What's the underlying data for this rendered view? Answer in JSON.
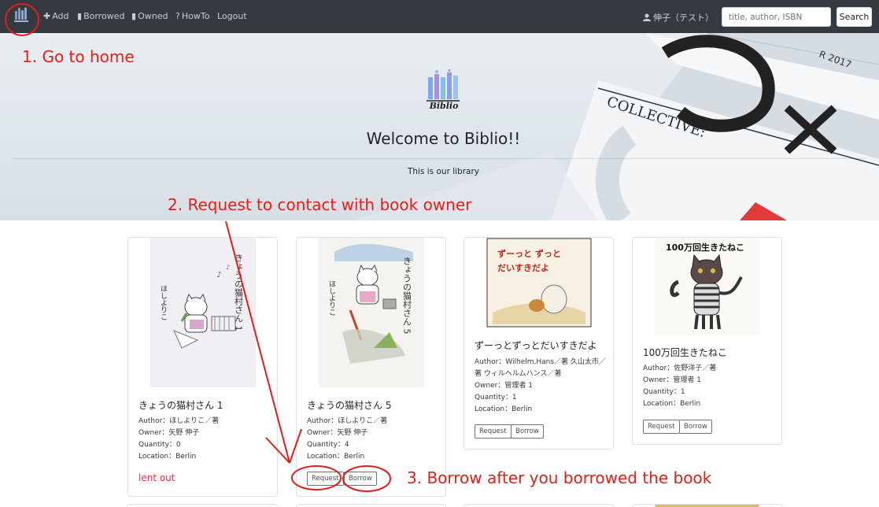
{
  "nav": {
    "add": "Add",
    "borrowed": "Borrowed",
    "owned": "Owned",
    "howto": "HowTo",
    "logout": "Logout",
    "user": "伸子（テスト）",
    "search_placeholder": "title, author, ISBN",
    "search_button": "Search"
  },
  "hero": {
    "logo_text": "Biblio",
    "title": "Welcome to Biblio!!",
    "subtitle": "This is our library"
  },
  "books": [
    {
      "title": "きょうの猫村さん 1",
      "author": "Author：ほしよりこ／著",
      "owner": "Owner：矢野 伸子",
      "quantity": "Quantity：0",
      "location": "Location：Berlin",
      "status": "lent out",
      "cover_text": "きょうの猫村さん 1",
      "cover_author": "ほしよりこ"
    },
    {
      "title": "きょうの猫村さん 5",
      "author": "Author：ほしよりこ／著",
      "owner": "Owner：矢野 伸子",
      "quantity": "Quantity：4",
      "location": "Location：Berlin",
      "cover_text": "きょうの猫村さん 5",
      "cover_author": "ほしよりこ"
    },
    {
      "title": "ずーっとずっとだいすきだよ",
      "author_line1": "Author：Wilhelm,Hans／著 久山太市／",
      "author_line2": "著 ウィルヘルムハンス／著",
      "owner": "Owner：管理者 1",
      "quantity": "Quantity：1",
      "location": "Location：Berlin",
      "cover_text_1": "ずーっと ずっと",
      "cover_text_2": "だいすきだよ"
    },
    {
      "title": "100万回生きたねこ",
      "author": "Author：佐野洋子／著",
      "owner": "Owner：管理者 1",
      "quantity": "Quantity：1",
      "location": "Location：Berlin",
      "cover_text": "100万回生きたねこ"
    }
  ],
  "buttons": {
    "request": "Request",
    "borrow": "Borrow"
  },
  "annotations": {
    "step1": "1. Go to home",
    "step2": "2. Request to contact with book owner",
    "step3": "3. Borrow after you borrowed the book"
  },
  "colors": {
    "navbar": "#343a40",
    "annotation": "#e0201b",
    "lent_out": "#dc3545"
  }
}
